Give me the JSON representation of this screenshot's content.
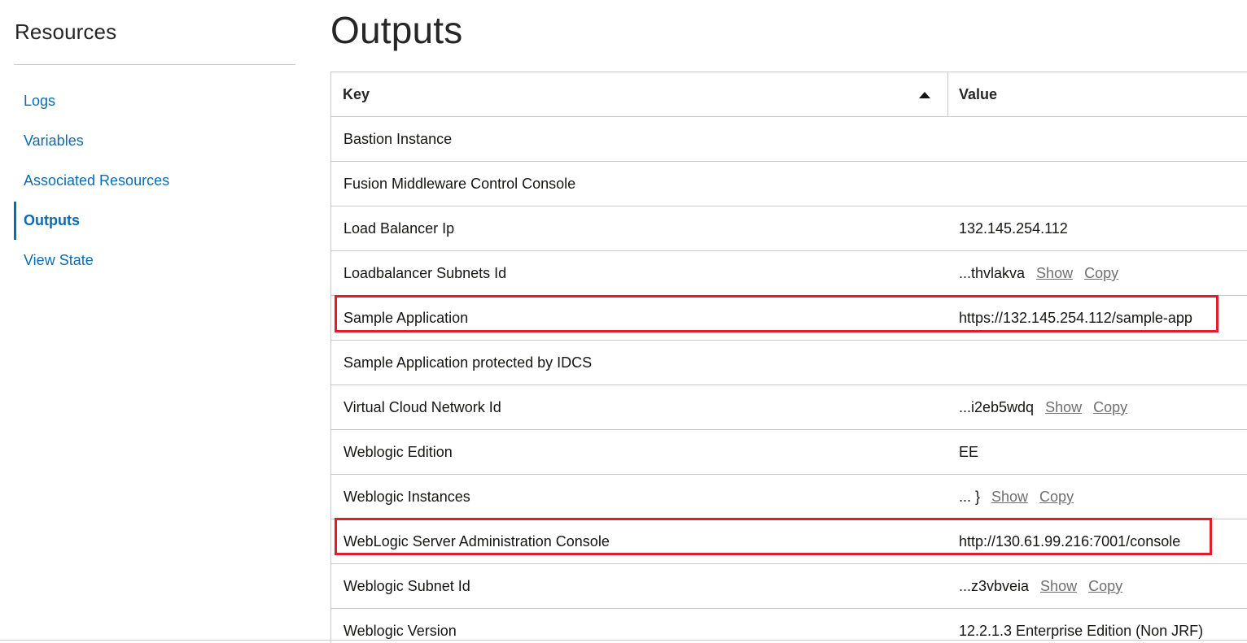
{
  "sidebar": {
    "title": "Resources",
    "items": [
      {
        "label": "Logs",
        "active": false
      },
      {
        "label": "Variables",
        "active": false
      },
      {
        "label": "Associated Resources",
        "active": false
      },
      {
        "label": "Outputs",
        "active": true
      },
      {
        "label": "View State",
        "active": false
      }
    ]
  },
  "main": {
    "title": "Outputs",
    "table": {
      "columns": {
        "key": "Key",
        "value": "Value"
      },
      "sort": "ascending",
      "rows": [
        {
          "key": "Bastion Instance",
          "value": ""
        },
        {
          "key": "Fusion Middleware Control Console",
          "value": ""
        },
        {
          "key": "Load Balancer Ip",
          "value": "132.145.254.112"
        },
        {
          "key": "Loadbalancer Subnets Id",
          "value": "...thvlakva",
          "show": "Show",
          "copy": "Copy"
        },
        {
          "key": "Sample Application",
          "value": "https://132.145.254.112/sample-app",
          "highlighted": true
        },
        {
          "key": "Sample Application protected by IDCS",
          "value": ""
        },
        {
          "key": "Virtual Cloud Network Id",
          "value": "...i2eb5wdq",
          "show": "Show",
          "copy": "Copy"
        },
        {
          "key": "Weblogic Edition",
          "value": "EE"
        },
        {
          "key": "Weblogic Instances",
          "value": "... }",
          "show": "Show",
          "copy": "Copy"
        },
        {
          "key": "WebLogic Server Administration Console",
          "value": "http://130.61.99.216:7001/console",
          "highlighted": true
        },
        {
          "key": "Weblogic Subnet Id",
          "value": "...z3vbveia",
          "show": "Show",
          "copy": "Copy"
        },
        {
          "key": "Weblogic Version",
          "value": "12.2.1.3 Enterprise Edition (Non JRF)"
        }
      ]
    }
  },
  "colors": {
    "link": "#0b6bb3",
    "highlight": "#e01e2b",
    "border": "#c9c9c9"
  }
}
